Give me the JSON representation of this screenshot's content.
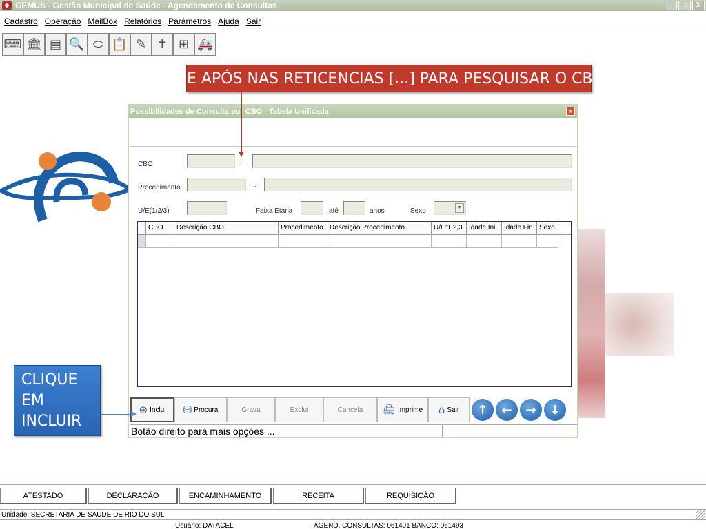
{
  "window": {
    "title": "GEMUS - Gestão Municipal de Saúde - Agendamento de Consultas",
    "controls": [
      "_",
      "□",
      "X"
    ]
  },
  "menu": [
    "Cadastro",
    "Operação",
    "MailBox",
    "Relatórios",
    "Parâmetros",
    "Ajuda",
    "Sair"
  ],
  "toolbar_icons": [
    "keyboard-icon",
    "building-icon",
    "printer-icon",
    "search-icon",
    "pill-icon",
    "clipboard-icon",
    "syringe-icon",
    "cross-icon",
    "medical-bag-icon",
    "ambulance-icon"
  ],
  "callouts": {
    "top": "E APÓS NAS RETICENCIAS [...] PARA PESQUISAR O CBO",
    "left": "CLIQUE EM INCLUIR"
  },
  "dialog": {
    "title": "Possibilidades de Consulta por CBO - Tabela Unificada",
    "close": "x",
    "labels": {
      "cbo": "CBO",
      "procedimento": "Procedimento",
      "ue": "U/E(1/2/3)",
      "faixa": "Faixa Etária",
      "ate": "até",
      "anos": "anos",
      "sexo": "Sexo"
    },
    "ellipsis": "...",
    "grid_headers": [
      "CBO",
      "Descrição CBO",
      "Procedimento",
      "Descrição Procedimento",
      "U/E:1,2,3",
      "Idade Ini.",
      "Idade Fin.",
      "Sexo"
    ],
    "buttons": {
      "inclui": "Inclui",
      "procura": "Procura",
      "grava": "Grava",
      "exclui": "Exclui",
      "cancela": "Cancela",
      "imprime": "Imprime",
      "sair": "Sair"
    },
    "status": "Botão direito para mais opções ..."
  },
  "bottom_buttons": [
    "ATESTADO",
    "DECLARAÇÃO",
    "ENCAMINHAMENTO",
    "RECEITA",
    "REQUISIÇÃO"
  ],
  "status_unit": "Unidade: SECRETARIA DE SAUDE DE RIO DO SUL",
  "status_user": "Usuário: DATACEL",
  "status_agend": "AGEND. CONSULTAS: 061401 BANCO: 061493"
}
